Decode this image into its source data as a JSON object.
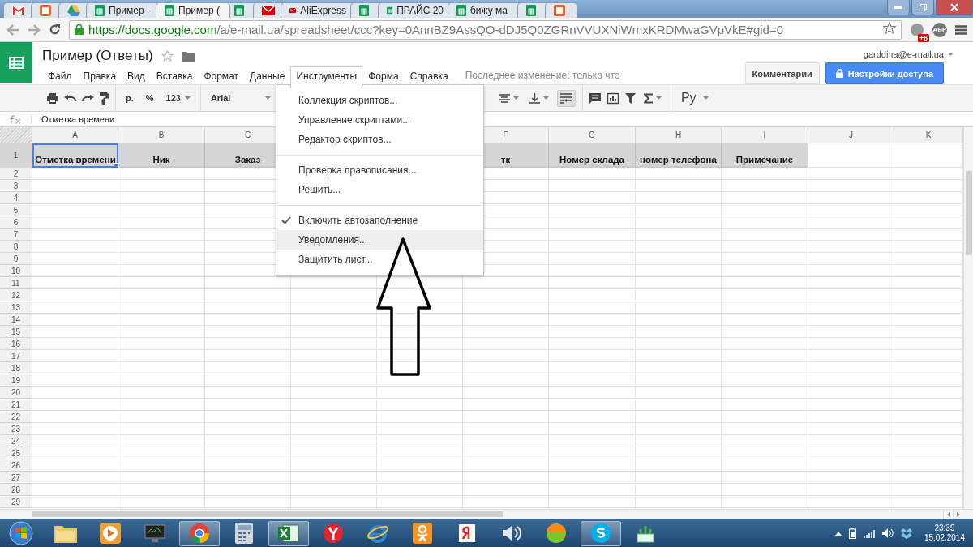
{
  "browser": {
    "tabs": [
      {
        "kind": "gmail",
        "selected": false
      },
      {
        "kind": "app",
        "selected": false
      },
      {
        "kind": "drive",
        "selected": false
      },
      {
        "kind": "sheets",
        "label": "Пример -",
        "selected": false
      },
      {
        "kind": "sheets",
        "label": "Пример (",
        "selected": true
      },
      {
        "kind": "sheets",
        "selected": false
      },
      {
        "kind": "mail",
        "selected": false
      },
      {
        "kind": "mail",
        "label": "AliExpress",
        "selected": false
      },
      {
        "kind": "sheets",
        "selected": false
      },
      {
        "kind": "sheets",
        "label": "ПРАЙС 20",
        "selected": false
      },
      {
        "kind": "sheets",
        "label": "бижу ма",
        "selected": false
      },
      {
        "kind": "sheets",
        "selected": false
      },
      {
        "kind": "app",
        "selected": false
      }
    ],
    "url": "https://docs.google.com/a/e-mail.ua/spreadsheet/ccc?key=0AnnBZ9AssQO-dDJ5Q0ZGRnVVUXNiWmxKRDMwaGVpVkE#gid=0",
    "extension_badge": "+6",
    "adblock_label": "ABP"
  },
  "document": {
    "title": "Пример (Ответы)",
    "account": "garddina@e-mail.ua",
    "menu": [
      {
        "label": "Файл",
        "selected": false
      },
      {
        "label": "Правка",
        "selected": false
      },
      {
        "label": "Вид",
        "selected": false
      },
      {
        "label": "Вставка",
        "selected": false
      },
      {
        "label": "Формат",
        "selected": false
      },
      {
        "label": "Данные",
        "selected": false
      },
      {
        "label": "Инструменты",
        "selected": true
      },
      {
        "label": "Форма",
        "selected": false
      },
      {
        "label": "Справка",
        "selected": false
      }
    ],
    "last_edit": "Последнее изменение: только что",
    "buttons": [
      {
        "kind": "plain",
        "label": "Комментарии"
      },
      {
        "kind": "primary",
        "label": "Настройки доступа"
      }
    ]
  },
  "toolbar": {
    "currency": "р.",
    "percent": "%",
    "number_format": "123",
    "font": "Arial",
    "input_tools": "Ру",
    "wrap_on": true
  },
  "formula_bar": {
    "value": "Отметка времени"
  },
  "sheet": {
    "columns": [
      {
        "kind": "column",
        "letter": "A",
        "field": "Отметка времени",
        "selected": true
      },
      {
        "kind": "column",
        "letter": "B",
        "field": "Ник",
        "selected": false
      },
      {
        "kind": "column",
        "letter": "C",
        "field": "Заказ",
        "selected": false
      },
      {
        "kind": "covered"
      },
      {
        "kind": "covered"
      },
      {
        "kind": "column",
        "letter": "F",
        "field": "тк",
        "selected": false
      },
      {
        "kind": "column",
        "letter": "G",
        "field": "Номер склада",
        "selected": false
      },
      {
        "kind": "column",
        "letter": "H",
        "field": "номер телефона",
        "selected": false
      },
      {
        "kind": "column",
        "letter": "I",
        "field": "Примечание",
        "selected": false
      },
      {
        "kind": "column",
        "letter": "J",
        "selected": false
      },
      {
        "kind": "column",
        "letter": "K",
        "selected": false
      }
    ],
    "rows": [
      "1",
      "2",
      "3",
      "4",
      "5",
      "6",
      "7",
      "8",
      "9",
      "10",
      "11",
      "12",
      "13",
      "14",
      "15",
      "16",
      "17",
      "18",
      "19",
      "20",
      "21",
      "22",
      "23",
      "24",
      "25",
      "26",
      "27",
      "28",
      "29"
    ]
  },
  "tools_menu": {
    "items": [
      {
        "kind": "item",
        "label": "Коллекция скриптов...",
        "checked": false,
        "selected": false
      },
      {
        "kind": "item",
        "label": "Управление скриптами...",
        "checked": false,
        "selected": false
      },
      {
        "kind": "item",
        "label": "Редактор скриптов...",
        "checked": false,
        "selected": false
      },
      {
        "kind": "separator"
      },
      {
        "kind": "item",
        "label": "Проверка правописания...",
        "checked": false,
        "selected": false
      },
      {
        "kind": "item",
        "label": "Решить...",
        "checked": false,
        "selected": false
      },
      {
        "kind": "separator"
      },
      {
        "kind": "item",
        "label": "Включить автозаполнение",
        "checked": true,
        "selected": false
      },
      {
        "kind": "item",
        "label": "Уведомления...",
        "checked": false,
        "selected": true
      },
      {
        "kind": "item",
        "label": "Защитить лист...",
        "checked": false,
        "selected": false
      }
    ]
  },
  "taskbar": {
    "apps": [
      {
        "kind": "folder",
        "running": false
      },
      {
        "kind": "player",
        "running": false
      },
      {
        "kind": "monitor",
        "running": false
      },
      {
        "kind": "chrome",
        "running": true
      },
      {
        "kind": "calculator",
        "running": false
      },
      {
        "kind": "excel",
        "running": true
      },
      {
        "kind": "yandex-browser",
        "running": false
      },
      {
        "kind": "ie",
        "running": false
      },
      {
        "kind": "ok",
        "running": false
      },
      {
        "kind": "yandex",
        "running": false
      },
      {
        "kind": "speaker",
        "running": false
      },
      {
        "kind": "orb",
        "running": false
      },
      {
        "kind": "skype",
        "running": true
      },
      {
        "kind": "network",
        "running": false
      }
    ],
    "time": "23:39",
    "date": "15.02.2014"
  }
}
